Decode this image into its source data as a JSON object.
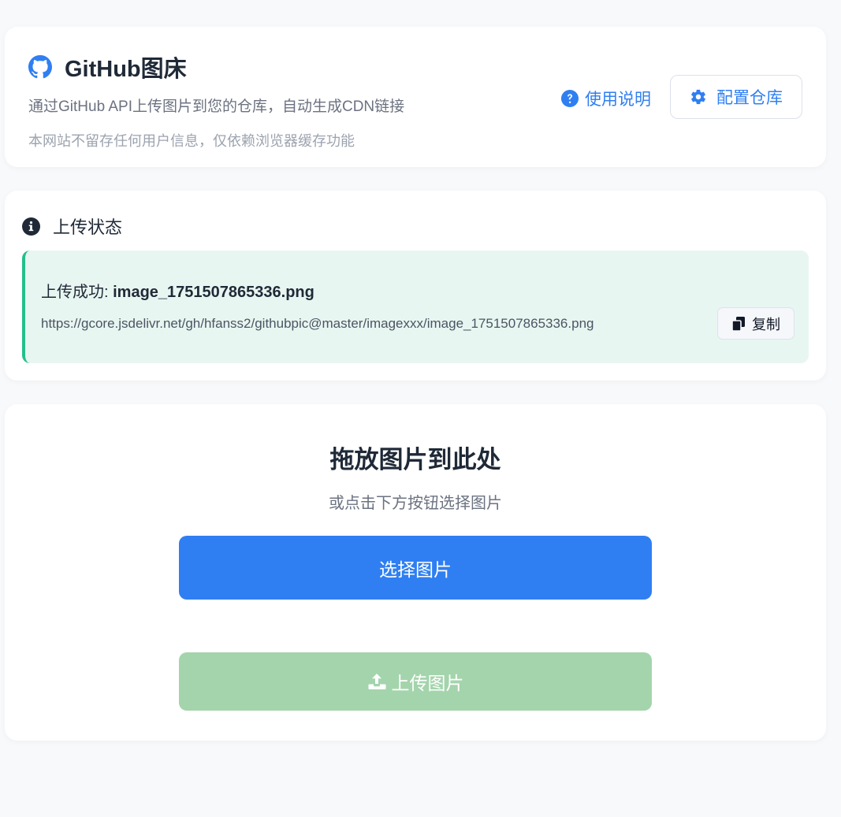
{
  "header": {
    "title": "GitHub图床",
    "subtitle": "通过GitHub API上传图片到您的仓库，自动生成CDN链接",
    "note": "本网站不留存任何用户信息，仅依赖浏览器缓存功能",
    "help_label": "使用说明",
    "config_label": "配置仓库",
    "icons": {
      "brand": "github-icon",
      "help": "question-circle-icon",
      "config": "gear-icon"
    }
  },
  "status": {
    "heading": "上传状态",
    "success_prefix": "上传成功:",
    "filename": "image_1751507865336.png",
    "url": "https://gcore.jsdelivr.net/gh/hfanss2/githubpic@master/imagexxx/image_1751507865336.png",
    "copy_label": "复制",
    "icons": {
      "heading": "info-circle-icon",
      "copy": "copy-icon"
    }
  },
  "upload": {
    "drop_title": "拖放图片到此处",
    "drop_subtitle": "或点击下方按钮选择图片",
    "select_label": "选择图片",
    "upload_label": "上传图片",
    "upload_disabled": true,
    "icons": {
      "upload": "upload-icon"
    }
  },
  "colors": {
    "accent": "#2f7ff2",
    "success_bg": "#e8f6f1",
    "success_border": "#22c08a",
    "upload_disabled": "#a4d4ac"
  }
}
